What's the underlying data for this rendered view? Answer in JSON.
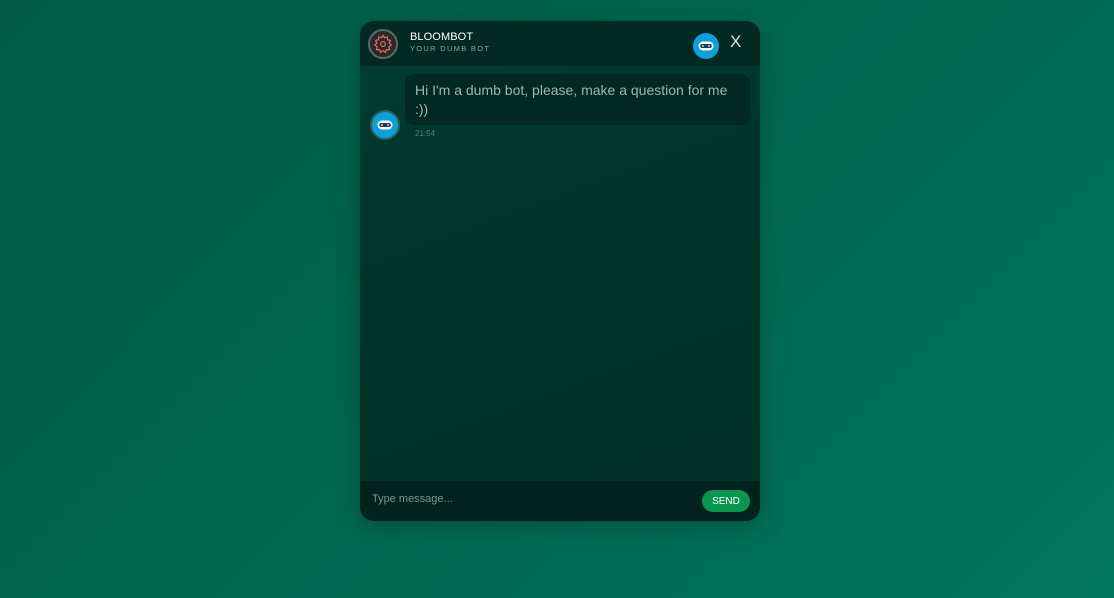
{
  "header": {
    "title": "BLOOMBOT",
    "subtitle": "YOUR DUMB BOT",
    "avatar_icon": "gear-flower-icon",
    "bot_icon": "bot-face-icon",
    "close_label": "X"
  },
  "messages": [
    {
      "sender": "bot",
      "avatar_icon": "bot-face-icon",
      "text": "Hi I'm a dumb bot, please, make a question for me :))",
      "time": "21:54"
    }
  ],
  "composer": {
    "placeholder": "Type message...",
    "send_label": "SEND"
  },
  "colors": {
    "accent_send": "#0a9650",
    "bot_avatar": "#0e9fd8",
    "background": "#00664f"
  }
}
